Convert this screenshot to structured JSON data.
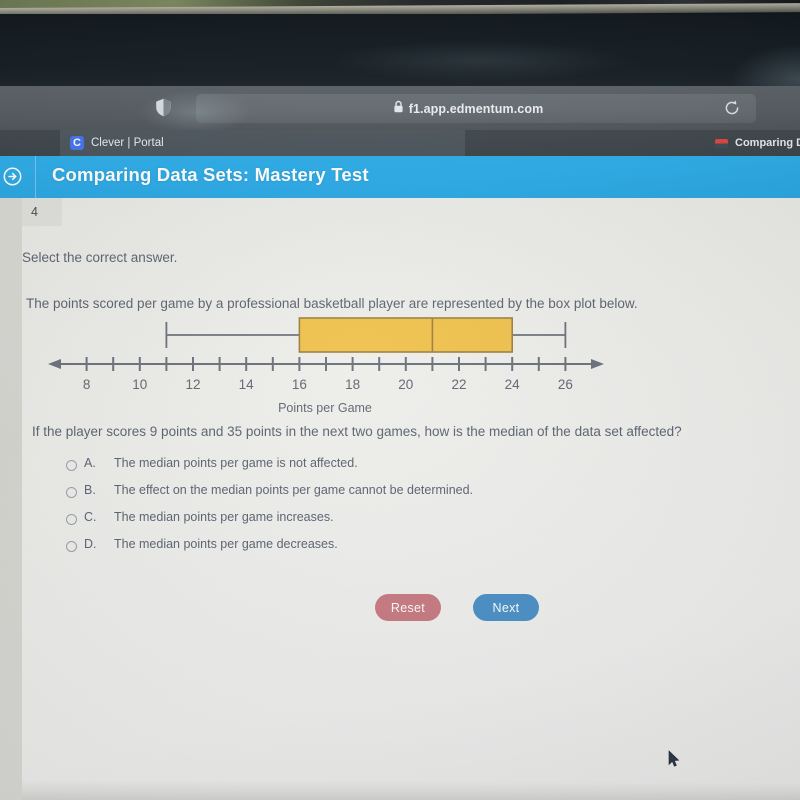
{
  "browser": {
    "url": "f1.app.edmentum.com",
    "lock_icon": "lock-icon",
    "shield_icon": "shield-icon",
    "reload_icon": "reload-icon",
    "tabs": [
      {
        "title": "Clever | Portal",
        "favicon": "clever-favicon",
        "active": true
      },
      {
        "title": "Comparing Dat",
        "favicon": "edmentum-favicon",
        "active": false
      }
    ]
  },
  "app_header": {
    "icon": "arrow-circle-right-icon",
    "title": "Comparing Data Sets: Mastery Test"
  },
  "question": {
    "number": "4",
    "instruction": "Select the correct answer.",
    "stem": "The points scored per game by a professional basketball player are represented by the box plot below.",
    "follow_up": "If the player scores 9 points and 35 points in the next two games, how is the median of the data set affected?",
    "choices": [
      {
        "letter": "A.",
        "text": "The median points per game is not affected.",
        "selected": false
      },
      {
        "letter": "B.",
        "text": "The effect on the median points per game cannot be determined.",
        "selected": false
      },
      {
        "letter": "C.",
        "text": "The median points per game increases.",
        "selected": false
      },
      {
        "letter": "D.",
        "text": "The median points per game decreases.",
        "selected": false
      }
    ]
  },
  "buttons": {
    "reset_label": "Reset",
    "reset_color": "#c87a80",
    "next_label": "Next",
    "next_color": "#4a90c8"
  },
  "chart_data": {
    "type": "box",
    "title": "",
    "xlabel": "Points per Game",
    "ylabel": "",
    "xlim": [
      7,
      27
    ],
    "tick_step": 1,
    "tick_labels": [
      "8",
      "10",
      "12",
      "14",
      "16",
      "18",
      "20",
      "22",
      "24",
      "26"
    ],
    "tick_label_values": [
      8,
      10,
      12,
      14,
      16,
      18,
      20,
      22,
      24,
      26
    ],
    "axis_arrows": "both",
    "grid": false,
    "series": [
      {
        "name": "Points per game",
        "min": 11,
        "q1": 16,
        "median": 21,
        "q3": 24,
        "max": 26,
        "box_fill": "#efc14b",
        "box_stroke": "#9a7f3f",
        "whisker_color": "#6a6f7a"
      }
    ]
  },
  "cursor": {
    "name": "mouse-pointer"
  }
}
